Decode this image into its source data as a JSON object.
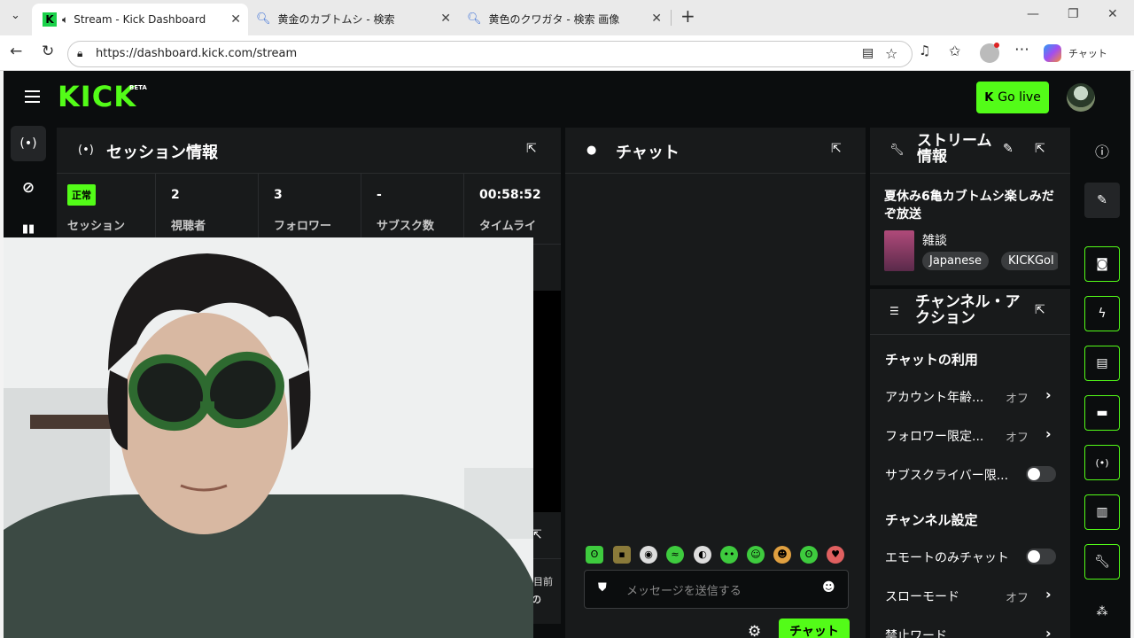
{
  "browser": {
    "tabs": [
      {
        "title": "Stream - Kick Dashboard",
        "active": true
      },
      {
        "title": "黄金のカブトムシ - 検索",
        "active": false
      },
      {
        "title": "黄色のクワガタ - 検索 画像",
        "active": false
      }
    ],
    "url": "https://dashboard.kick.com/stream",
    "copilot_label": "チャット"
  },
  "app": {
    "logo": "KICK",
    "beta": "BETA",
    "go_live": "Go live",
    "accent": "#53fc18"
  },
  "session": {
    "title": "セッション情報",
    "status_badge": "正常",
    "stats": [
      {
        "value": "",
        "label": "セッション"
      },
      {
        "value": "2",
        "label": "視聴者"
      },
      {
        "value": "3",
        "label": "フォロワー"
      },
      {
        "value": "-",
        "label": "サブスク数"
      },
      {
        "value": "00:58:52",
        "label": "タイムライ"
      }
    ]
  },
  "chat": {
    "title": "チャット",
    "placeholder": "メッセージを送信する",
    "send_label": "チャット",
    "peek_text": "目前",
    "peek_text2": "の"
  },
  "stream_info": {
    "title": "ストリーム情報",
    "stream_title": "夏休み6亀カブトムシ楽しみだぞ放送",
    "category": "雑談",
    "tags": [
      "Japanese",
      "KICKGol"
    ]
  },
  "channel_actions": {
    "title": "チャンネル・アクション",
    "chat_usage_heading": "チャットの利用",
    "rows": [
      {
        "label": "アカウント年齢...",
        "value": "オフ"
      },
      {
        "label": "フォロワー限定...",
        "value": "オフ"
      },
      {
        "label": "サブスクライバー限...",
        "value": ""
      }
    ],
    "channel_settings_heading": "チャンネル設定",
    "rows2": [
      {
        "label": "エモートのみチャット",
        "value": ""
      },
      {
        "label": "スローモード",
        "value": "オフ"
      },
      {
        "label": "禁止ワード",
        "value": ""
      }
    ]
  }
}
